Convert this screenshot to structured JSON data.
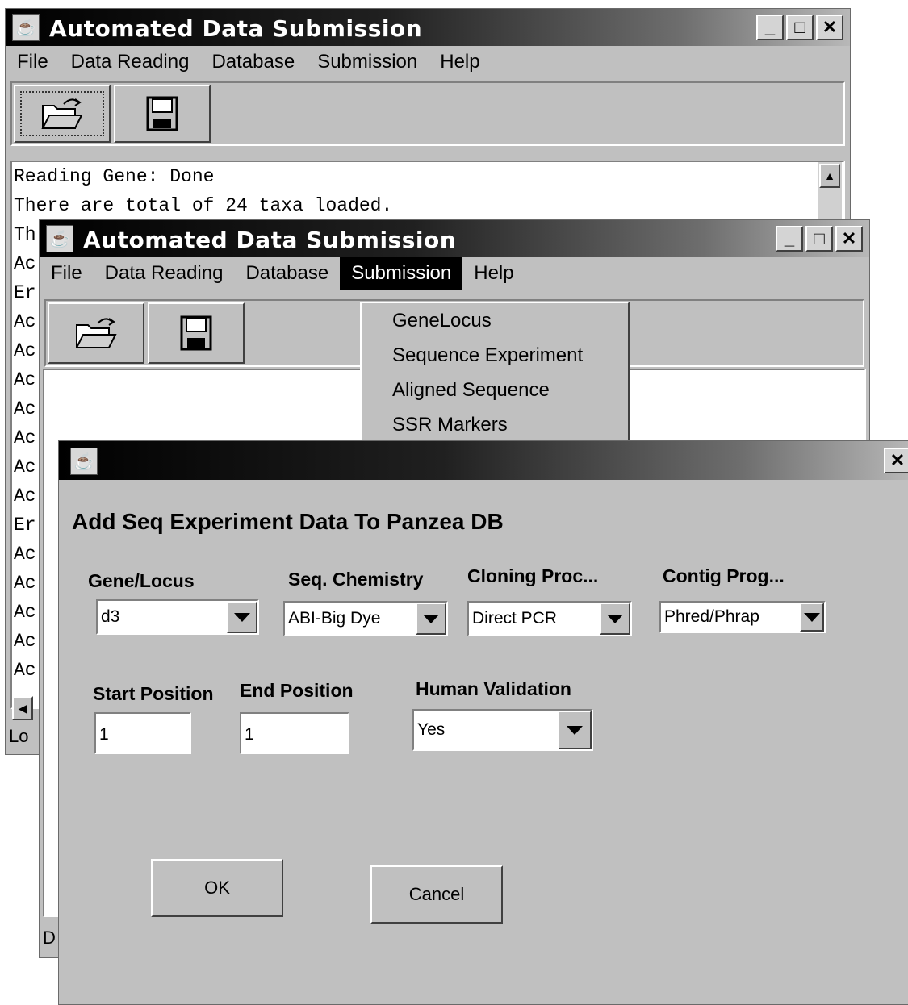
{
  "back_window": {
    "title": "Automated Data Submission",
    "menu": [
      "File",
      "Data Reading",
      "Database",
      "Submission",
      "Help"
    ],
    "log_lines": [
      "Reading Gene: Done",
      "There are total of 24 taxa loaded.",
      "Th",
      "Ac",
      "Er",
      "Ac",
      "Ac",
      "Ac",
      "Ac",
      "Ac",
      "Ac",
      "Ac",
      "Er",
      "Ac",
      "Ac",
      "Ac",
      "Ac",
      "Ac"
    ],
    "status_text": "Lo"
  },
  "mid_window": {
    "title": "Automated Data Submission",
    "menu": [
      "File",
      "Data Reading",
      "Database",
      "Submission",
      "Help"
    ],
    "active_menu": "Submission",
    "submission_menu_items": [
      "GeneLocus",
      "Sequence Experiment",
      "Aligned Sequence",
      "SSR Markers"
    ],
    "status_text": "D"
  },
  "dialog": {
    "heading": "Add Seq Experiment  Data To Panzea DB",
    "fields": {
      "gene_locus": {
        "label": "Gene/Locus",
        "value": "d3"
      },
      "seq_chemistry": {
        "label": "Seq. Chemistry",
        "value": "ABI-Big Dye"
      },
      "cloning_proc": {
        "label": "Cloning Proc...",
        "value": "Direct PCR"
      },
      "contig_prog": {
        "label": "Contig Prog...",
        "value": "Phred/Phrap"
      },
      "start_position": {
        "label": "Start Position",
        "value": "1"
      },
      "end_position": {
        "label": "End Position",
        "value": "1"
      },
      "human_validation": {
        "label": "Human Validation",
        "value": "Yes"
      }
    },
    "ok_label": "OK",
    "cancel_label": "Cancel"
  },
  "icons": {
    "app": "coffee-cup-icon",
    "open": "open-folder-icon",
    "save": "floppy-disk-icon",
    "minimize": "minimize-icon",
    "maximize": "maximize-icon",
    "close": "close-icon"
  }
}
